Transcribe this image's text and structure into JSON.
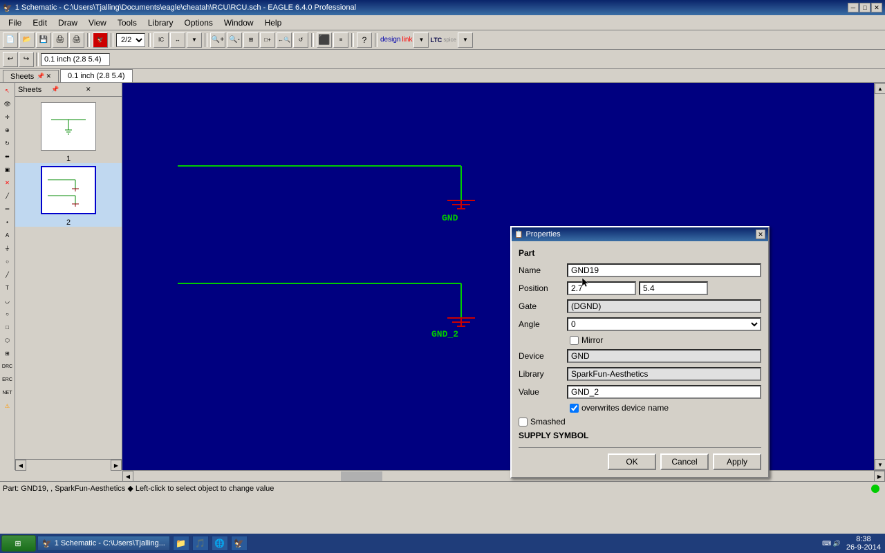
{
  "window": {
    "title": "1 Schematic - C:\\Users\\Tjalling\\Documents\\eagle\\cheatah\\RCU\\RCU.sch - EAGLE 6.4.0 Professional",
    "icon": "🦅"
  },
  "menu": {
    "items": [
      "File",
      "Edit",
      "Draw",
      "View",
      "Tools",
      "Library",
      "Options",
      "Window",
      "Help"
    ]
  },
  "toolbar": {
    "sheet_selector": "2/2",
    "coord_display": "0.1 inch (2.8 5.4)"
  },
  "tabs": [
    {
      "label": "Sheets",
      "active": false
    },
    {
      "label": "0.1 inch (2.8 5.4)",
      "active": true
    }
  ],
  "sheets_panel": {
    "title": "Sheets",
    "sheets": [
      {
        "number": "1",
        "active": false
      },
      {
        "number": "2",
        "active": true
      }
    ]
  },
  "canvas": {
    "background": "#000080"
  },
  "properties_dialog": {
    "title": "Properties",
    "section": "Part",
    "fields": {
      "name_label": "Name",
      "name_value": "GND19",
      "position_label": "Position",
      "position_x": "2.7",
      "position_y": "5.4",
      "gate_label": "Gate",
      "gate_value": "(DGND)",
      "angle_label": "Angle",
      "angle_value": "0",
      "mirror_label": "Mirror",
      "mirror_checked": false,
      "device_label": "Device",
      "device_value": "GND",
      "library_label": "Library",
      "library_value": "SparkFun-Aesthetics",
      "value_label": "Value",
      "value_value": "GND_2",
      "overwrites_label": "overwrites device name",
      "overwrites_checked": true,
      "smashed_label": "Smashed",
      "smashed_checked": false,
      "supply_symbol": "SUPPLY SYMBOL"
    },
    "buttons": {
      "ok": "OK",
      "cancel": "Cancel",
      "apply": "Apply"
    }
  },
  "statusbar": {
    "text": "Part: GND19, , SparkFun-Aesthetics  ◆  Left-click to select object to change value"
  },
  "taskbar": {
    "start_label": "Start",
    "app_item": "1 Schematic - C:\\Users\\Tjalling...",
    "time": "8:38",
    "date": "26-9-2014"
  },
  "schematic": {
    "gnd_label_1": "GND",
    "gnd_label_2": "GND_2"
  }
}
